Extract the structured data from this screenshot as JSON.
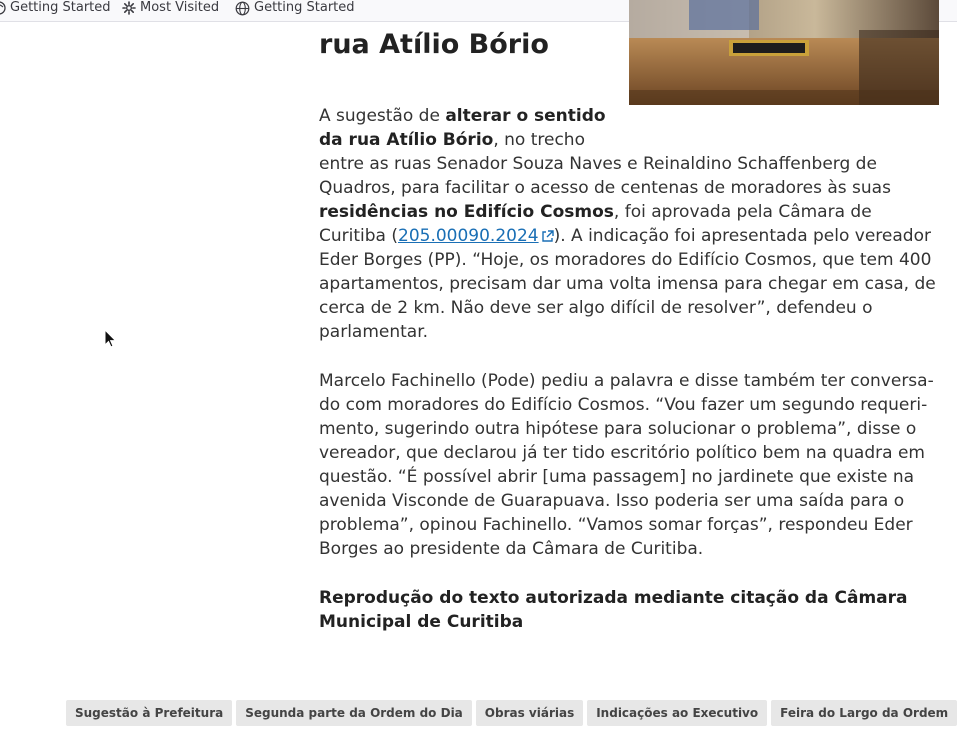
{
  "bookmarks": [
    {
      "label": "Getting Started",
      "icon": "firefox-icon"
    },
    {
      "label": "Most Visited",
      "icon": "gear-icon"
    },
    {
      "label": "Getting Started",
      "icon": "globe-icon"
    }
  ],
  "article": {
    "title_line_partial": "... ... ...",
    "title_line": "rua Atílio Bório",
    "para1": {
      "t1": "A sugestão de ",
      "b1": "alterar o sentido da rua Atílio Bório",
      "t2": ", no trecho en­tre as ruas Senador Souza Naves e Reinaldino Schaffenberg de Quadros, para facilitar o acesso de centenas de moradores às suas ",
      "b2": "residências no Edifício Cosmos",
      "t3": ", foi aprovada pela Câmara de Curitiba (",
      "link": "205.00090.2024",
      "t4": "). A indicação foi apresentada pelo vereador Eder Borges (PP). “Hoje, os moradores do Edifício Cosmos, que tem 400 apar­tamentos, precisam dar uma volta imensa para chegar em casa, de cerca de 2 km. Não deve ser algo difícil de resolver”, defendeu o parlamentar."
    },
    "para2": "Marcelo Fachinello (Pode) pediu a palavra e disse também ter conversa­do com moradores do Edifício Cosmos. “Vou fazer um segundo requeri­mento, sugerindo outra hipótese para solucionar o problema”, disse o ve­reador, que declarou já ter tido escritório político bem na quadra em questão. “É possível abrir [uma passagem] no jardinete que existe na ave­nida Visconde de Guarapuava. Isso poderia ser uma saída para o proble­ma”, opinou Fachinello. “Vamos somar forças”, respondeu Eder Borges ao presidente da Câmara de Curitiba.",
    "reproduction": "Reprodução do texto autorizada mediante citação da Câmara Municipal de Curitiba"
  },
  "tags": [
    "Sugestão à Prefeitura",
    "Segunda parte da Ordem do Dia",
    "Obras viárias",
    "Indicações ao Executivo",
    "Feira do Largo da Ordem"
  ],
  "colors": {
    "link": "#1a6fb5",
    "tag_bg": "#e7e7e7",
    "text": "#333333"
  }
}
